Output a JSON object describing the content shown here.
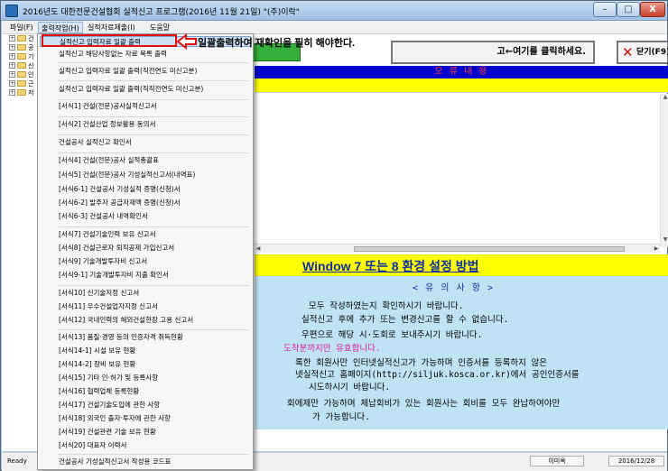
{
  "window": {
    "title": "2016년도 대한전문건설협회 실적신고 프로그램(2016년 11월 21일)  \"(주)이락\"",
    "min_label": "–",
    "max_label": "□",
    "close_label": "X"
  },
  "menubar": {
    "items": [
      {
        "label": "파일(F)"
      },
      {
        "label": "출력작업(H)"
      },
      {
        "label": "실적자료제출(I)"
      },
      {
        "label": "도움말"
      }
    ]
  },
  "tree": {
    "rows": [
      {
        "label": "건"
      },
      {
        "label": "공"
      },
      {
        "label": "기"
      },
      {
        "label": "신"
      },
      {
        "label": "인"
      },
      {
        "label": "근"
      },
      {
        "label": "저"
      }
    ]
  },
  "toolbar": {
    "click_here_label": "고←여기를 클릭하세요.",
    "close_label": "닫기(F9)"
  },
  "error_header": "오 류 내 용",
  "banner": {
    "title": "Window 7 또는 8 환경 설정 방법"
  },
  "notes": {
    "title": "< 유 의 사 항 >",
    "lines": [
      "모두 작성하였는지 확인하시기 바랍니다.",
      "실적신고 후에 추가 또는 변경신고를 할 수 없습니다.",
      "우편으로 해당 시·도회로 보내주시기 바랍니다.",
      "도착분까지만 유효합니다.",
      "록한 회원사만 인터넷실적신고가 가능하며 인증서를 등록하지 않은",
      "넷실적신고 홈페이지(http://siljuk.kosca.or.kr)에서 공인인증서를",
      "시도하시기 바랍니다.",
      "회에제만 가능하며 체납회비가 있는 회원사는 회비를 모두 완납하여야만",
      "가 가능합니다."
    ]
  },
  "dropdown": {
    "items": [
      "실적신고 입력자료 일괄 출력",
      "실적신고 해당사항없는 자료 목록 출력",
      "실적신고 입력자료 일괄 출력(직전연도 미신고분)",
      "실적신고 입력자료 일괄 출력(직직전연도 미신고분)",
      "[서식1] 건설(전문)공사실적신고서",
      "[서식2] 건설산업 정보활용 동의서",
      "건설공사 실적신고 확인서",
      "[서식4] 건설(전문)공사 실적총괄표",
      "[서식5] 건설(전문)공사 기성실적신고서(내역표)",
      "[서식6-1] 건설공사 기성실적 증명(신청)서",
      "[서식6-2] 발주자 공급자재액 증명(신청)서",
      "[서식6-3] 건설공사 내역확인서",
      "[서식7] 건설기술인력 보유 신고서",
      "[서식8] 건설근로자 퇴직공제 가입신고서",
      "[서식9] 기술개발투자비 신고서",
      "[서식9-1] 기술개발투자비 지출 확인서",
      "[서식10] 신기술지정 신고서",
      "[서식11] 우수건설업자지정 신고서",
      "[서식12] 국내인력의 해외건설현장 고용 신고서",
      "[서식13] 품질·경영 등의 인증자격 취득현황",
      "[서식14-1] 시설 보유 현황",
      "[서식14-2] 장비 보유 현황",
      "[서식15] 기타 인·허가 및 등록사항",
      "[서식16] 협력업체 등록현황",
      "[서식17] 건설기술도입에 관한 사항",
      "[서식18] 외국인 출자·투자에 관한 사항",
      "[서식19] 건설관련 기술 보유 현황",
      "[서식20] 대표자 이력서",
      "건설공사 기성실적신고서 작성용 코드표"
    ]
  },
  "annotation": {
    "callout": "일괄출력하여 재확인을 필히 해야한다.",
    "color": "#e01010"
  },
  "statusbar": {
    "ready": "Ready",
    "user": "이미옥",
    "date": "2016/12/28"
  },
  "colors": {
    "error_bar": "#0000cc",
    "error_text": "#ff4040",
    "banner_bg": "#ffff00",
    "notes_bg": "#bfe3f4",
    "highlight_pink": "#e020a0"
  }
}
